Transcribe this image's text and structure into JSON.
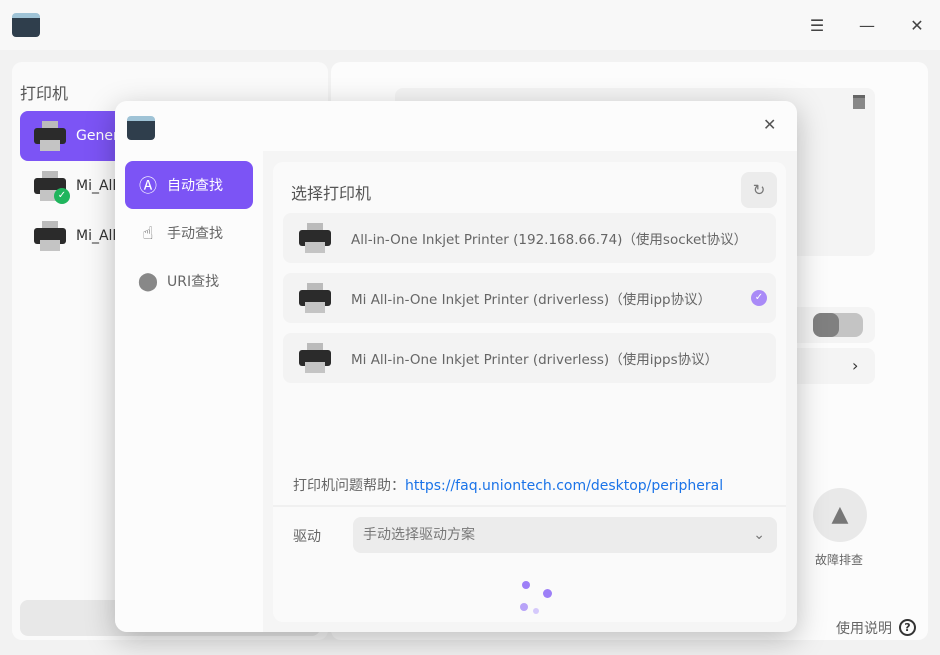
{
  "window": {
    "menu_icon": "menu-icon",
    "minimize_icon": "minimize-icon",
    "close_icon": "close-icon"
  },
  "sidebar": {
    "title": "打印机",
    "items": [
      {
        "label": "Gener"
      },
      {
        "label": "Mi_All"
      },
      {
        "label": "Mi_All"
      }
    ]
  },
  "right": {
    "troubleshoot_label": "故障排查",
    "help_label": "使用说明"
  },
  "dialog": {
    "nav": [
      {
        "label": "自动查找"
      },
      {
        "label": "手动查找"
      },
      {
        "label": "URI查找"
      }
    ],
    "section_title": "选择打印机",
    "printers": [
      {
        "label": "All-in-One Inkjet Printer (192.168.66.74)（使用socket协议）",
        "selected": false
      },
      {
        "label": "Mi All-in-One Inkjet Printer (driverless)（使用ipp协议）",
        "selected": true
      },
      {
        "label": "Mi All-in-One Inkjet Printer (driverless)（使用ipps协议）",
        "selected": false
      }
    ],
    "help_prefix": "打印机问题帮助：",
    "help_link": "https://faq.uniontech.com/desktop/peripheral",
    "driver_label": "驱动",
    "driver_value": "手动选择驱动方案"
  },
  "colors": {
    "accent": "#7c54f5",
    "link": "#1a73e8"
  }
}
